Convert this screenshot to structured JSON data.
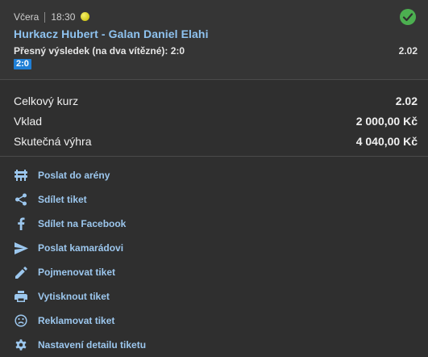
{
  "bet": {
    "day": "Včera",
    "time": "18:30",
    "sport_icon": "tennis-ball-icon",
    "status_icon": "check-circle-icon",
    "status_color": "#4caf50",
    "match": "Hurkacz Hubert - Galan Daniel Elahi",
    "market": "Přesný výsledek (na dva vítězné): 2:0",
    "odds": "2.02",
    "selection": "2:0"
  },
  "summary": {
    "total_odds_label": "Celkový kurz",
    "total_odds_value": "2.02",
    "stake_label": "Vklad",
    "stake_value": "2 000,00 Kč",
    "win_label": "Skutečná výhra",
    "win_value": "4 040,00 Kč"
  },
  "actions": [
    {
      "icon": "arena-icon",
      "label": "Poslat do arény"
    },
    {
      "icon": "share-icon",
      "label": "Sdílet tiket"
    },
    {
      "icon": "facebook-icon",
      "label": "Sdílet na Facebook"
    },
    {
      "icon": "send-icon",
      "label": "Poslat kamarádovi"
    },
    {
      "icon": "pencil-icon",
      "label": "Pojmenovat tiket"
    },
    {
      "icon": "printer-icon",
      "label": "Vytisknout tiket"
    },
    {
      "icon": "sad-face-icon",
      "label": "Reklamovat tiket"
    },
    {
      "icon": "gear-icon",
      "label": "Nastavení detailu tiketu"
    }
  ],
  "colors": {
    "accent": "#9cc7ee",
    "badge": "#1f7fd6"
  }
}
